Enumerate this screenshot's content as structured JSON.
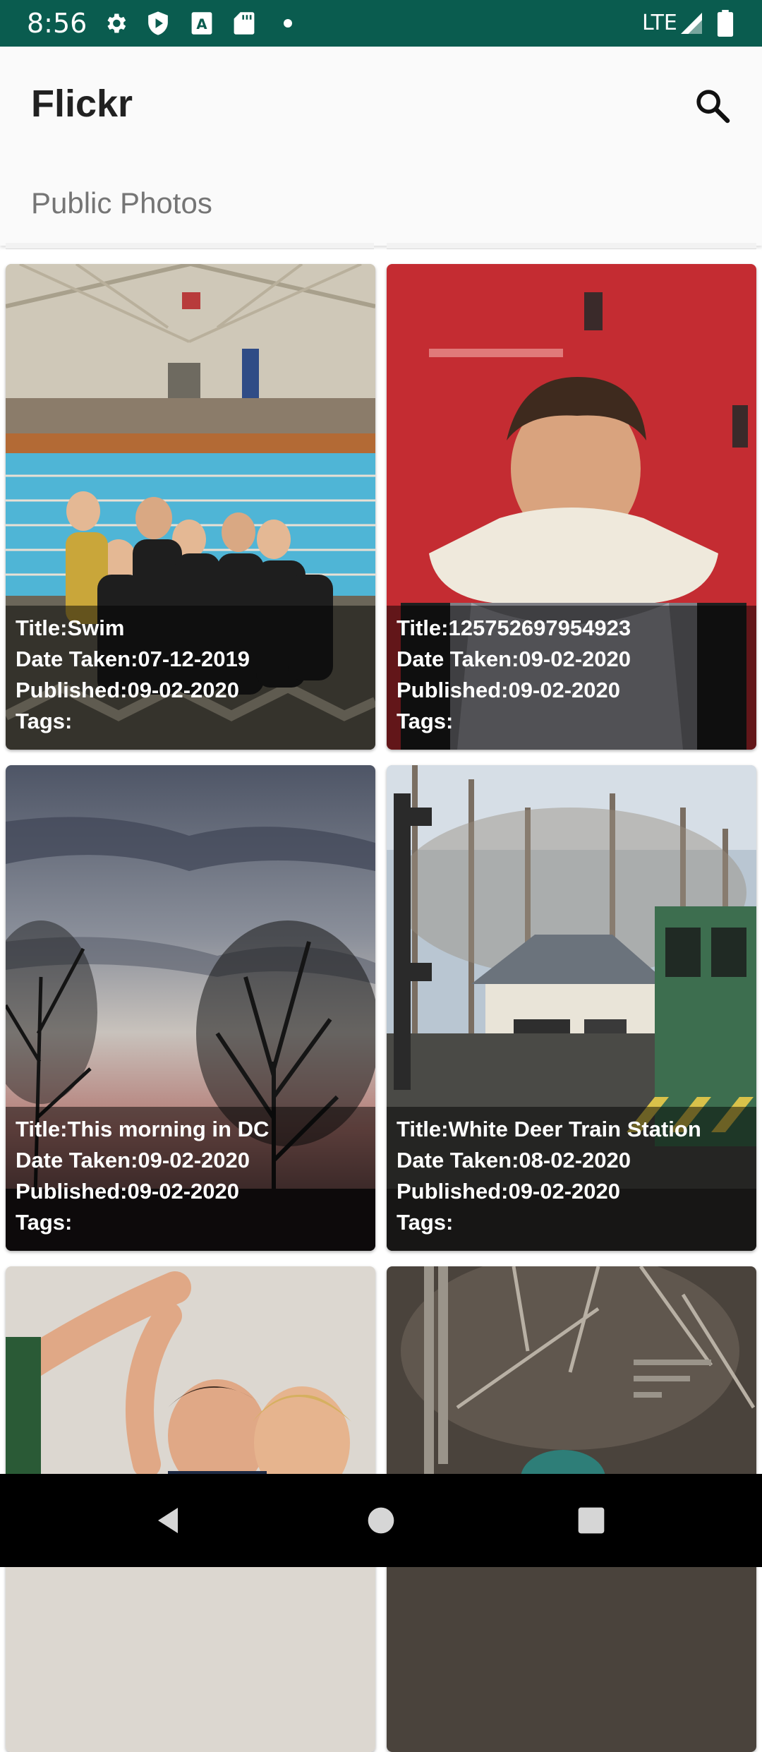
{
  "status_bar": {
    "time": "8:56",
    "network": "LTE",
    "icons": [
      "settings-icon",
      "play-protect-icon",
      "font-a-icon",
      "sd-card-icon",
      "dot-icon",
      "signal-icon",
      "battery-icon"
    ]
  },
  "app_bar": {
    "title": "Flickr",
    "subtitle": "Public Photos",
    "search_icon": "search-icon"
  },
  "colors": {
    "status_bar": "#0a5c4f",
    "app_bar": "#fafafa",
    "overlay": "rgba(0,0,0,0.5)"
  },
  "photos": [
    {
      "title": "Title:Swim",
      "date_taken": "Date Taken:07-12-2019",
      "published": "Published:09-02-2020",
      "tags": "Tags:"
    },
    {
      "title": "Title:125752697954923",
      "date_taken": "Date Taken:09-02-2020",
      "published": "Published:09-02-2020",
      "tags": "Tags:"
    },
    {
      "title": "Title:This morning in DC",
      "date_taken": "Date Taken:09-02-2020",
      "published": "Published:09-02-2020",
      "tags": "Tags:"
    },
    {
      "title": "Title:White Deer Train Station",
      "date_taken": "Date Taken:08-02-2020",
      "published": "Published:09-02-2020",
      "tags": "Tags:"
    }
  ],
  "nav_bar": {
    "icons": [
      "back-icon",
      "home-icon",
      "recents-icon"
    ]
  }
}
